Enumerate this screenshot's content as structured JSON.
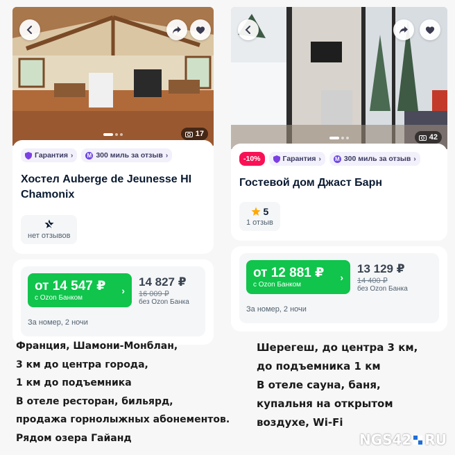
{
  "listings": [
    {
      "photo_count": "17",
      "badges": {
        "guarantee": "Гарантия",
        "miles": "300 миль за отзыв"
      },
      "title": "Хостел Auberge de Jeunesse HI Chamonix",
      "reviews": "нет отзывов",
      "price": {
        "ozon_price": "от 14 547 ₽",
        "ozon_label": "с Ozon Банком",
        "price": "14 827 ₽",
        "old_price": "16 009 ₽",
        "label": "без Ozon Банка"
      },
      "per_night": "За номер, 2 ночи",
      "caption": [
        "Франция, Шамони-Монблан,",
        "3 км до центра города,",
        "1 км до подъемника",
        "В отеле ресторан, бильярд,",
        "продажа горнолыжных абонементов.",
        "Рядом озера Гайанд"
      ]
    },
    {
      "photo_count": "42",
      "badges": {
        "discount": "-10%",
        "guarantee": "Гарантия",
        "miles": "300 миль за отзыв"
      },
      "title": "Гостевой дом Джаст Барн",
      "rating": "5",
      "reviews": "1 отзыв",
      "price": {
        "ozon_price": "от 12 881 ₽",
        "ozon_label": "с Ozon Банком",
        "price": "13 129 ₽",
        "old_price": "14 400 ₽",
        "label": "без Ozon Банка"
      },
      "per_night": "За номер, 2 ночи",
      "caption": [
        "Шерегеш, до центра 3 км,",
        "до подъемника 1 км",
        "В отеле сауна, баня,",
        "купальня на открытом",
        "воздухе, Wi-Fi"
      ]
    }
  ],
  "watermark": {
    "left": "NGS42",
    "right": "RU"
  },
  "colors": {
    "green": "#10c44c",
    "discount": "#f91155",
    "badge_bg": "#f2f0fb"
  }
}
